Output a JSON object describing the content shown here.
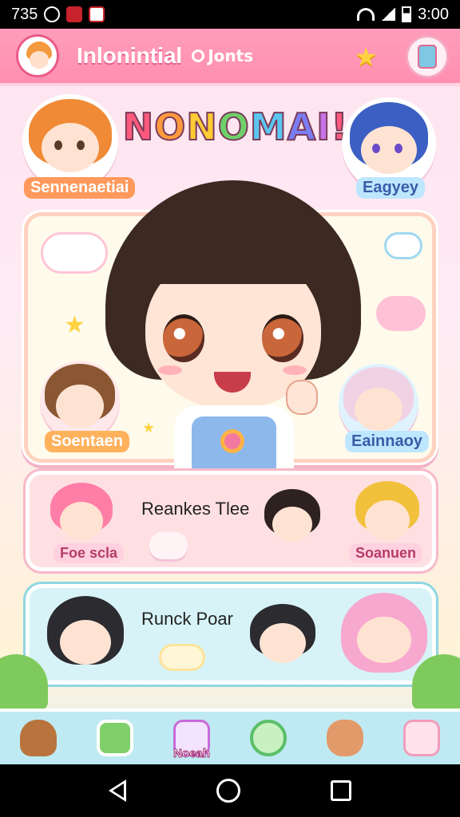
{
  "status_bar": {
    "time_left": "735",
    "time_right": "3:00"
  },
  "header": {
    "title": "Inlonintial",
    "subtitle": "Jonts",
    "icons": [
      "avatar",
      "coin-icon",
      "star-icon",
      "shop-icon"
    ]
  },
  "banner": {
    "title_letters": [
      "N",
      "O",
      "N",
      "O",
      "M",
      "A",
      "I",
      "!"
    ],
    "title_colors": [
      "#ff5a7d",
      "#ff9b3d",
      "#ffcc33",
      "#6fd06a",
      "#5bc6f0",
      "#7a7ef5",
      "#c773e8",
      "#ff5a7d"
    ],
    "left_hero_label": "Sennenaetiai",
    "right_hero_label": "Eagyey"
  },
  "main_card": {
    "left_label": "Soentaen",
    "right_label": "Eainnaoy"
  },
  "rows": [
    {
      "title": "Reankes Tlee",
      "left_label": "Foe scla",
      "right_label": "Soanuen"
    },
    {
      "title": "Runck Poar"
    }
  ],
  "bottom_nav": {
    "center_label": "Noeah",
    "items": [
      "bear-icon",
      "tv-icon",
      "menu-icon",
      "globe-icon",
      "dog-icon",
      "shop-cart-icon"
    ]
  },
  "colors": {
    "header_pink": "#ff8fb1",
    "card_cream": "#fffbec",
    "row1_bg": "#ffe0e2",
    "row2_bg": "#d7f3f7",
    "nav_bg": "#bfeaf3"
  }
}
